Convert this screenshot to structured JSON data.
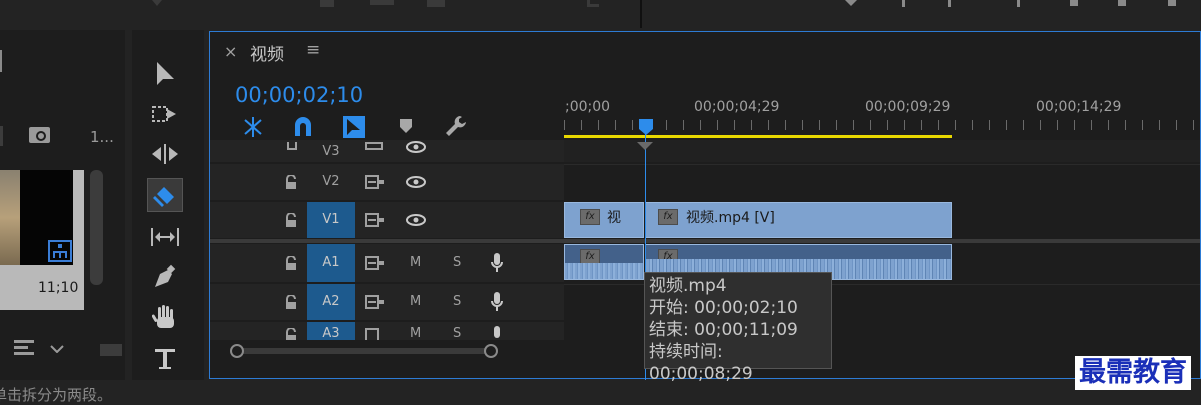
{
  "sequence_panel": {
    "close_glyph": "×",
    "title": "视频",
    "menu_glyph": "≡",
    "timecode": "00;00;02;10"
  },
  "ruler": {
    "labels": [
      ";00;00",
      "00;00;04;29",
      "00;00;09;29",
      "00;00;14;29"
    ]
  },
  "tracks": {
    "video": [
      {
        "id": "V3",
        "active": false
      },
      {
        "id": "V2",
        "active": false
      },
      {
        "id": "V1",
        "active": true
      }
    ],
    "audio": [
      {
        "id": "A1",
        "active": true,
        "mute": "M",
        "solo": "S"
      },
      {
        "id": "A2",
        "active": true,
        "mute": "M",
        "solo": "S"
      },
      {
        "id": "A3",
        "active": true,
        "mute": "M",
        "solo": "S"
      }
    ]
  },
  "clips": {
    "v1_left_label": "视",
    "v1_right_label": "视频.mp4 [V]",
    "fx_label": "fx"
  },
  "tooltip": {
    "line1": "视频.mp4",
    "line2": "开始: 00;00;02;10",
    "line3": "结束: 00;00;11;09",
    "line4": "持续时间: 00;00;08;29"
  },
  "left_panel": {
    "item_count": "1...",
    "thumb_timecode": "11;10"
  },
  "status_bar": {
    "text": "单击拆分为两段。"
  },
  "watermark": {
    "text": "最需教育"
  },
  "colors": {
    "accent_blue": "#2d8ceb",
    "clip_blue": "#7ea2cf",
    "track_active": "#1d5a8e",
    "playhead": "#2d8ceb",
    "work_area": "#e8d800"
  },
  "icons": [
    "selection-tool-icon",
    "track-select-forward-icon",
    "ripple-edit-icon",
    "razor-tool-icon",
    "slip-tool-icon",
    "pen-tool-icon",
    "hand-tool-icon",
    "type-tool-icon",
    "snap-icon",
    "linked-selection-icon",
    "add-marker-icon",
    "wrench-icon",
    "eye-icon",
    "lock-icon",
    "mic-icon"
  ]
}
